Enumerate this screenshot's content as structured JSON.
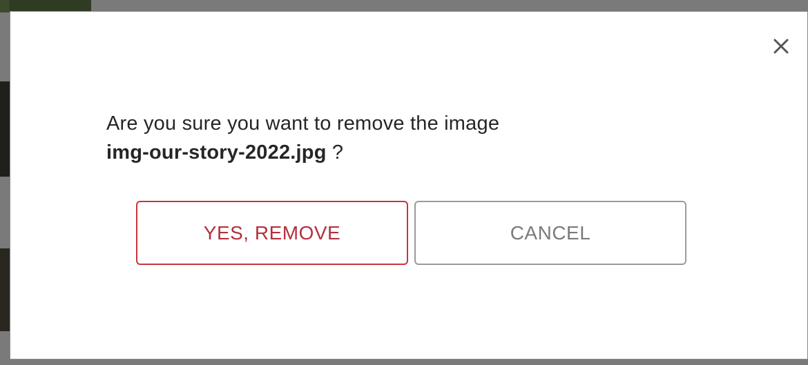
{
  "dialog": {
    "message": "Are you sure you want to remove the image",
    "filename": "img-our-story-2022.jpg",
    "question_mark": " ?",
    "confirm_label": "YES, REMOVE",
    "cancel_label": "CANCEL",
    "close_icon": "close-icon"
  },
  "colors": {
    "confirm_border": "#c9333f",
    "confirm_text": "#b3303c",
    "cancel_border": "#9a9a9a",
    "cancel_text": "#7a7a7a"
  }
}
